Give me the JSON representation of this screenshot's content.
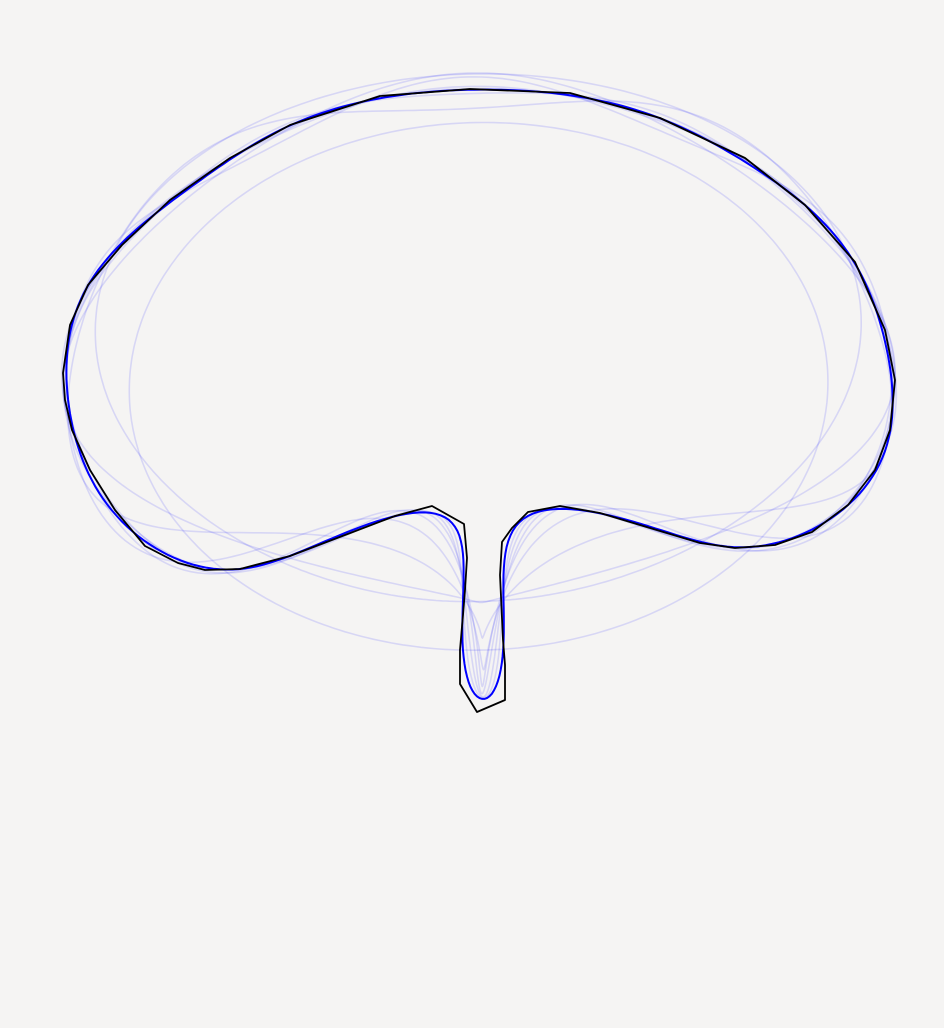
{
  "canvas": {
    "background_color": "#f5f4f3"
  },
  "outline": {
    "name": "target-shape",
    "stroke_color": "#000000"
  },
  "approximations": {
    "stroke_color": "#0000ff",
    "faint_opacity": 0.12,
    "final_opacity": 1.0,
    "levels": [
      1,
      2,
      3,
      4,
      5,
      6,
      7,
      8,
      9,
      10
    ]
  }
}
